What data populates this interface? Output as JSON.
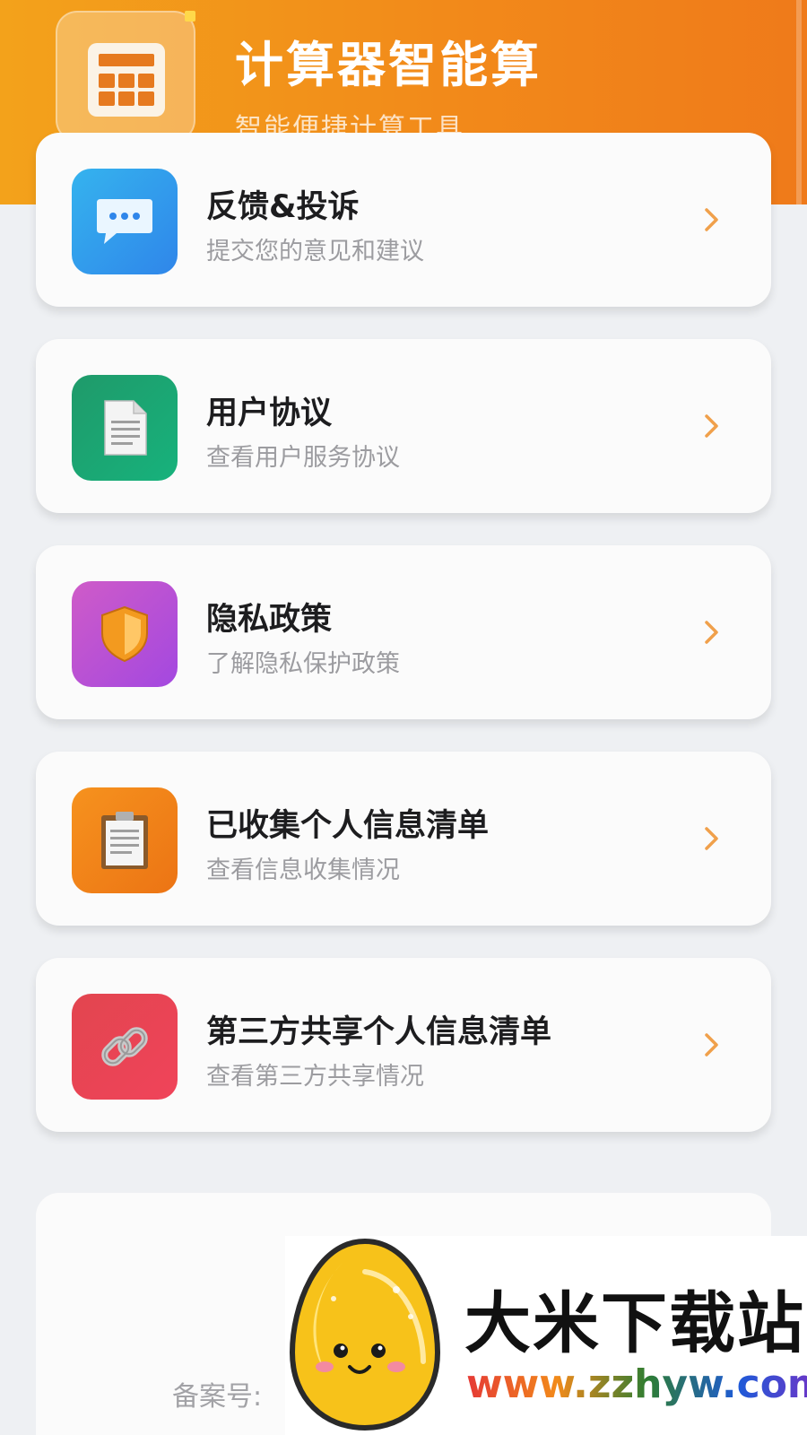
{
  "header": {
    "app_title": "计算器智能算",
    "app_subtitle": "智能便捷计算工具",
    "app_icon": "calculator-icon"
  },
  "menu": {
    "items": [
      {
        "title": "反馈&投诉",
        "desc": "提交您的意见和建议",
        "icon": "chat-bubble-icon",
        "color_from": "#35b3ee",
        "color_to": "#2f86ea"
      },
      {
        "title": "用户协议",
        "desc": "查看用户服务协议",
        "icon": "document-icon",
        "color_from": "#1f9a6a",
        "color_to": "#17b27c"
      },
      {
        "title": "隐私政策",
        "desc": "了解隐私保护政策",
        "icon": "shield-icon",
        "color_from": "#cf5bc8",
        "color_to": "#a348e0"
      },
      {
        "title": "已收集个人信息清单",
        "desc": "查看信息收集情况",
        "icon": "clipboard-icon",
        "color_from": "#f6921e",
        "color_to": "#ec7414"
      },
      {
        "title": "第三方共享个人信息清单",
        "desc": "查看第三方共享情况",
        "icon": "link-icon",
        "color_from": "#e2454f",
        "color_to": "#f0445a"
      }
    ],
    "chevron_icon": "chevron-right-icon",
    "chevron_color": "#f0a04b"
  },
  "footer": {
    "record_label": "备案号:"
  },
  "watermark": {
    "name": "大米下载站",
    "url": "www.zzhyw.com"
  },
  "colors": {
    "header_start": "#f3a21b",
    "header_end": "#ef7a1a",
    "background": "#eef0f3"
  }
}
